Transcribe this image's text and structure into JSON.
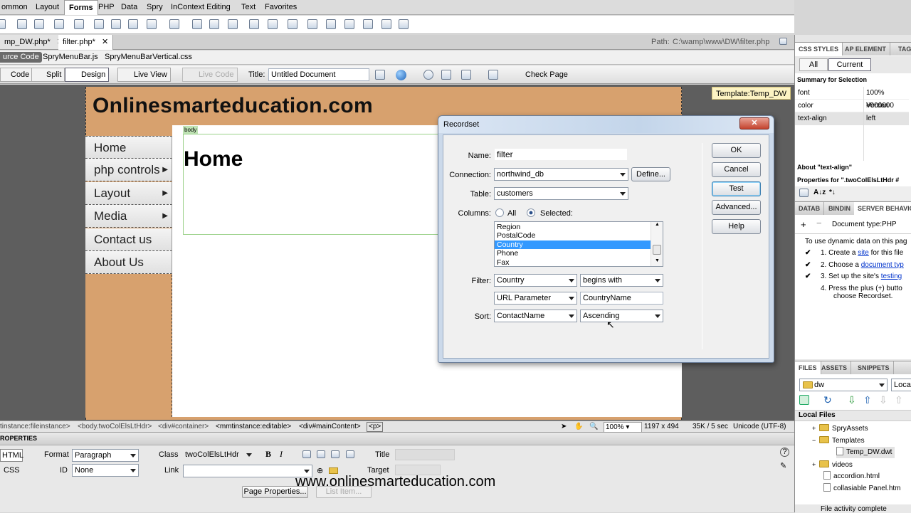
{
  "insert_bar": {
    "tabs": [
      "ommon",
      "Layout",
      "Forms",
      "PHP",
      "Data",
      "Spry",
      "InContext Editing",
      "Text",
      "Favorites"
    ],
    "active": "Forms"
  },
  "doc_tabs": {
    "tabs": [
      "mp_DW.php*",
      "filter.php*"
    ],
    "path_label": "Path:",
    "path_value": "C:\\wamp\\www\\DW\\filter.php"
  },
  "related_files": [
    "urce Code",
    "SpryMenuBar.js",
    "SpryMenuBarVertical.css"
  ],
  "doc_toolbar": {
    "code": "Code",
    "split": "Split",
    "design": "Design",
    "live_view": "Live View",
    "live_code": "Live Code",
    "title_label": "Title:",
    "title_value": "Untitled Document",
    "check_page": "Check Page"
  },
  "template_label": "Template:Temp_DW",
  "page": {
    "site_title": "Onlinesmarteducation.com",
    "body_tag": "body",
    "heading": "Home",
    "menu": [
      {
        "label": "Home",
        "sub": false
      },
      {
        "label": "php controls",
        "sub": true
      },
      {
        "label": "Layout",
        "sub": true
      },
      {
        "label": "Media",
        "sub": true
      },
      {
        "label": "Contact us",
        "sub": false
      },
      {
        "label": "About Us",
        "sub": false
      }
    ]
  },
  "dialog": {
    "title": "Recordset",
    "name_label": "Name:",
    "name_value": "filter",
    "connection_label": "Connection:",
    "connection_value": "northwind_db",
    "define_button": "Define...",
    "table_label": "Table:",
    "table_value": "customers",
    "columns_label": "Columns:",
    "all_label": "All",
    "selected_label": "Selected:",
    "columns": [
      "Region",
      "PostalCode",
      "Country",
      "Phone",
      "Fax"
    ],
    "selected_column": "Country",
    "filter_label": "Filter:",
    "filter_column": "Country",
    "filter_op": "begins with",
    "filter_source": "URL Parameter",
    "filter_value": "CountryName",
    "sort_label": "Sort:",
    "sort_column": "ContactName",
    "sort_order": "Ascending",
    "buttons": {
      "ok": "OK",
      "cancel": "Cancel",
      "test": "Test",
      "advanced": "Advanced...",
      "help": "Help"
    }
  },
  "status_bar": {
    "tags": [
      "tinstance:fileinstance>",
      "<body.twoColElsLtHdr>",
      "<div#container>",
      "<mmtinstance:editable>",
      "<div#mainContent>",
      "<p>"
    ],
    "zoom": "100%",
    "size": "1197 x 494",
    "download": "35K / 5 sec",
    "encoding": "Unicode (UTF-8)"
  },
  "properties": {
    "title": "ROPERTIES",
    "html": "HTML",
    "css": "CSS",
    "format_label": "Format",
    "format_value": "Paragraph",
    "class_label": "Class",
    "class_value": "twoColElsLtHdr",
    "id_label": "ID",
    "id_value": "None",
    "link_label": "Link",
    "title_label": "Title",
    "target_label": "Target",
    "page_properties": "Page Properties...",
    "list_item": "List Item..."
  },
  "watermark": "www.onlinesmarteducation.com",
  "css_panel": {
    "tabs": [
      "CSS STYLES",
      "AP ELEMENT",
      "TAG IN"
    ],
    "all": "All",
    "current": "Current",
    "summary": "Summary for Selection",
    "props": [
      {
        "name": "font",
        "value": "100% Verdan"
      },
      {
        "name": "color",
        "value": "#000000"
      },
      {
        "name": "text-align",
        "value": "left"
      }
    ],
    "about": "About \"text-align\"",
    "properties_for": "Properties for \".twoColElsLtHdr #"
  },
  "server_panel": {
    "tabs": [
      "DATAB",
      "BINDIN",
      "SERVER BEHAVIO"
    ],
    "doctype": "Document type:PHP",
    "intro": "To use dynamic data on this pag",
    "steps": [
      {
        "check": true,
        "text": "1.  Create a ",
        "link": "site",
        "rest": " for this file"
      },
      {
        "check": true,
        "text": "2.  Choose a ",
        "link": "document typ",
        "rest": ""
      },
      {
        "check": true,
        "text": "3.  Set up the site's ",
        "link": "testing",
        "rest": ""
      },
      {
        "check": false,
        "text": "4.  Press the plus (+) butto",
        "link": "",
        "rest": ""
      }
    ],
    "step4b": "choose Recordset."
  },
  "files_panel": {
    "tabs": [
      "FILES",
      "ASSETS",
      "SNIPPETS"
    ],
    "site": "dw",
    "view": "Local",
    "local_files": "Local Files",
    "items": [
      "SpryAssets",
      "Templates",
      "Temp_DW.dwt",
      "videos",
      "accordion.html",
      "collasiable Panel.htm"
    ],
    "log": "File activity complete"
  },
  "colors": {
    "page_bg": "#d7a16e",
    "accent": "#3399ff",
    "selection": "#3399ff"
  }
}
